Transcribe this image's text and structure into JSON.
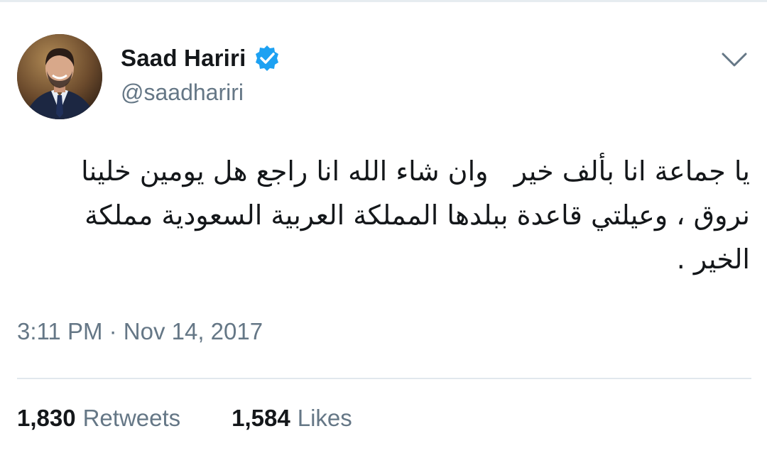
{
  "tweet": {
    "author": {
      "display_name": "Saad Hariri",
      "handle": "@saadhariri",
      "verified": true,
      "verified_color": "#1da1f2"
    },
    "text": "يا جماعة انا بألف خير   وان شاء الله انا راجع هل يومين خلينا نروق ، وعيلتي قاعدة ببلدها المملكة العربية السعودية مملكة الخير .",
    "timestamp": "3:11 PM · Nov 14, 2017",
    "stats": {
      "retweets_count": "1,830",
      "retweets_label": "Retweets",
      "likes_count": "1,584",
      "likes_label": "Likes"
    },
    "menu_icon": "chevron-down-icon"
  },
  "colors": {
    "text_primary": "#14171a",
    "text_secondary": "#657786",
    "accent": "#1da1f2",
    "divider": "#e1e8ed"
  }
}
